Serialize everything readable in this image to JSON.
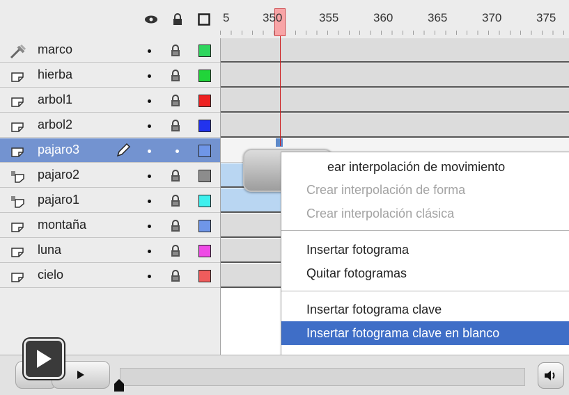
{
  "header": {
    "ruler_labels": [
      "5",
      "350",
      "355",
      "360",
      "365",
      "370",
      "375"
    ],
    "icons": [
      "eye-icon",
      "lock-icon",
      "outline-icon"
    ]
  },
  "layers": [
    {
      "name": "marco",
      "type": "guide",
      "color": "#2fd65e",
      "selected": false
    },
    {
      "name": "hierba",
      "type": "normal",
      "color": "#21d43a",
      "selected": false
    },
    {
      "name": "arbol1",
      "type": "normal",
      "color": "#ee2222",
      "selected": false
    },
    {
      "name": "arbol2",
      "type": "normal",
      "color": "#2233ee",
      "selected": false
    },
    {
      "name": "pajaro3",
      "type": "normal",
      "color": "#6f96e8",
      "selected": true
    },
    {
      "name": "pajaro2",
      "type": "motion-guided",
      "color": "#8c8c8c",
      "selected": false
    },
    {
      "name": "pajaro1",
      "type": "motion-guided",
      "color": "#3ef0ee",
      "selected": false
    },
    {
      "name": "montaña",
      "type": "normal",
      "color": "#6f96e8",
      "selected": false
    },
    {
      "name": "luna",
      "type": "normal",
      "color": "#ef4be6",
      "selected": false
    },
    {
      "name": "cielo",
      "type": "normal",
      "color": "#ef5c5c",
      "selected": false
    }
  ],
  "menu": {
    "items": [
      {
        "label": "ear interpolación de movimiento",
        "state": "enabled"
      },
      {
        "label": "Crear interpolación de forma",
        "state": "disabled"
      },
      {
        "label": "Crear interpolación clásica",
        "state": "disabled"
      },
      {
        "label": "Insertar fotograma",
        "state": "enabled"
      },
      {
        "label": "Quitar fotogramas",
        "state": "enabled"
      },
      {
        "label": "Insertar fotograma clave",
        "state": "enabled"
      },
      {
        "label": "Insertar fotograma clave en blanco",
        "state": "highlighted"
      }
    ]
  },
  "colors": {
    "selection": "#7393d0",
    "menu_highlight": "#3f6ec7",
    "playhead": "#cc1d1f"
  }
}
